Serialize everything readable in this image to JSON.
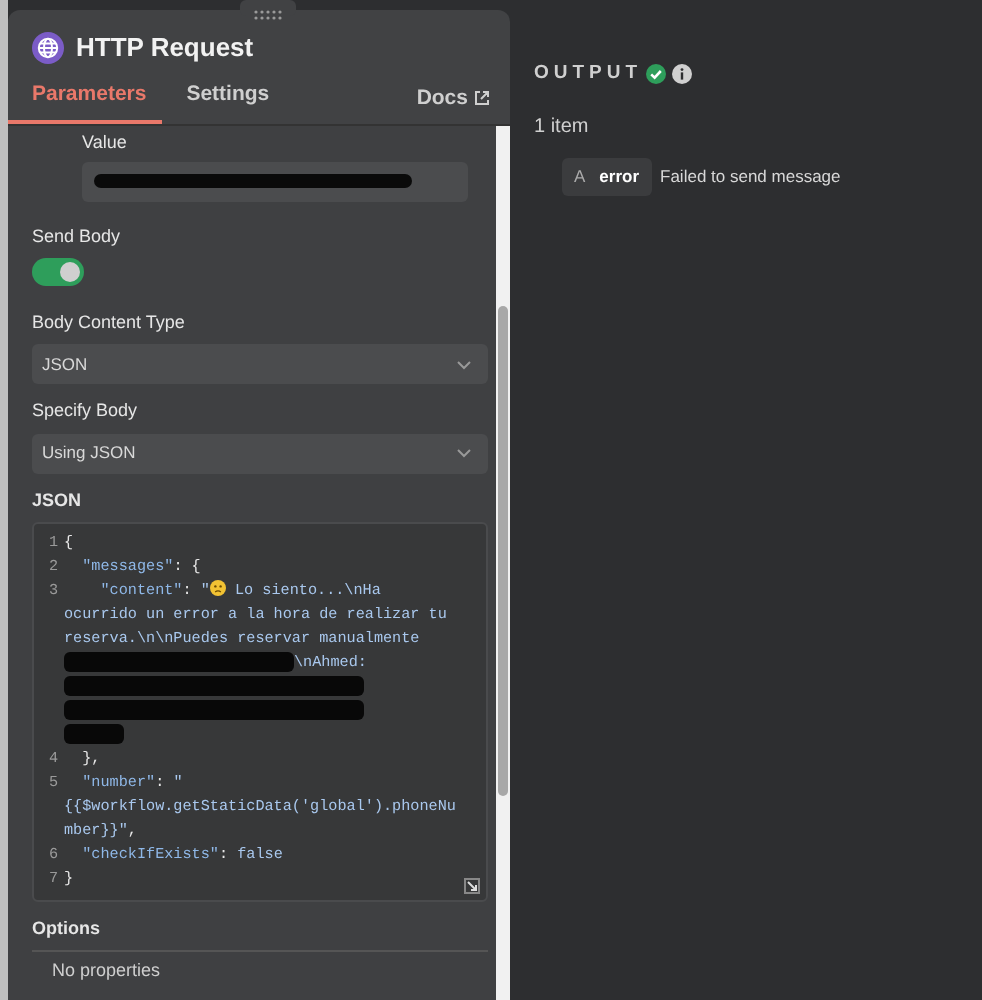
{
  "node": {
    "title": "HTTP Request"
  },
  "tabs": [
    {
      "label": "Parameters",
      "selected": true
    },
    {
      "label": "Settings",
      "selected": false
    }
  ],
  "docs_link": "Docs",
  "fields": [
    {
      "kind": "redacted",
      "label": "Value"
    },
    {
      "kind": "toggle",
      "label": "Send Body",
      "on": true
    },
    {
      "kind": "select",
      "label": "Body Content Type",
      "value": "JSON"
    },
    {
      "kind": "select",
      "label": "Specify Body",
      "value": "Using JSON"
    }
  ],
  "editor": {
    "label": "JSON",
    "rows": [
      {
        "number": "1",
        "segments": [
          {
            "kind": "punct",
            "text": "{"
          }
        ]
      },
      {
        "number": "2",
        "segments": [
          {
            "kind": "key",
            "text": "  \"messages\""
          },
          {
            "kind": "punct",
            "text": ": {"
          }
        ]
      },
      {
        "number": "3",
        "segments": [
          {
            "kind": "key",
            "text": "    \"content\""
          },
          {
            "kind": "punct",
            "text": ": "
          },
          {
            "kind": "string",
            "text": "\""
          },
          {
            "kind": "emoji"
          },
          {
            "kind": "string",
            "text": " Lo siento...\\nHa"
          }
        ]
      },
      {
        "segments": [
          {
            "kind": "string",
            "text": "ocurrido un error a la hora de realizar tu"
          }
        ]
      },
      {
        "segments": [
          {
            "kind": "string",
            "text": "reserva.\\n\\nPuedes reservar manualmente"
          }
        ]
      },
      {
        "segments": [
          {
            "kind": "redaction"
          },
          {
            "kind": "string",
            "text": "\\nAhmed:"
          }
        ]
      },
      {
        "segments": [
          {
            "kind": "redaction"
          }
        ]
      },
      {
        "segments": [
          {
            "kind": "redaction"
          }
        ]
      },
      {
        "segments": [
          {
            "kind": "redaction"
          }
        ]
      },
      {
        "number": "4",
        "segments": [
          {
            "kind": "punct",
            "text": "  },"
          }
        ]
      },
      {
        "number": "5",
        "segments": [
          {
            "kind": "key",
            "text": "  \"number\""
          },
          {
            "kind": "punct",
            "text": ": "
          },
          {
            "kind": "string",
            "text": "\""
          }
        ]
      },
      {
        "segments": [
          {
            "kind": "string",
            "text": "{{$workflow.getStaticData('global').phoneNu"
          }
        ]
      },
      {
        "segments": [
          {
            "kind": "string",
            "text": "mber}}\""
          },
          {
            "kind": "punct",
            "text": ","
          }
        ]
      },
      {
        "number": "6",
        "segments": [
          {
            "kind": "key",
            "text": "  \"checkIfExists\""
          },
          {
            "kind": "punct",
            "text": ": "
          },
          {
            "kind": "string",
            "text": "false"
          }
        ]
      },
      {
        "number": "7",
        "segments": [
          {
            "kind": "punct",
            "text": "}"
          }
        ]
      }
    ]
  },
  "options": {
    "label": "Options",
    "empty_text": "No properties"
  },
  "output": {
    "title": "OUTPUT",
    "count": "1 item",
    "items": [
      {
        "type_badge": "A",
        "key": "error",
        "value": "Failed to send message"
      }
    ]
  }
}
